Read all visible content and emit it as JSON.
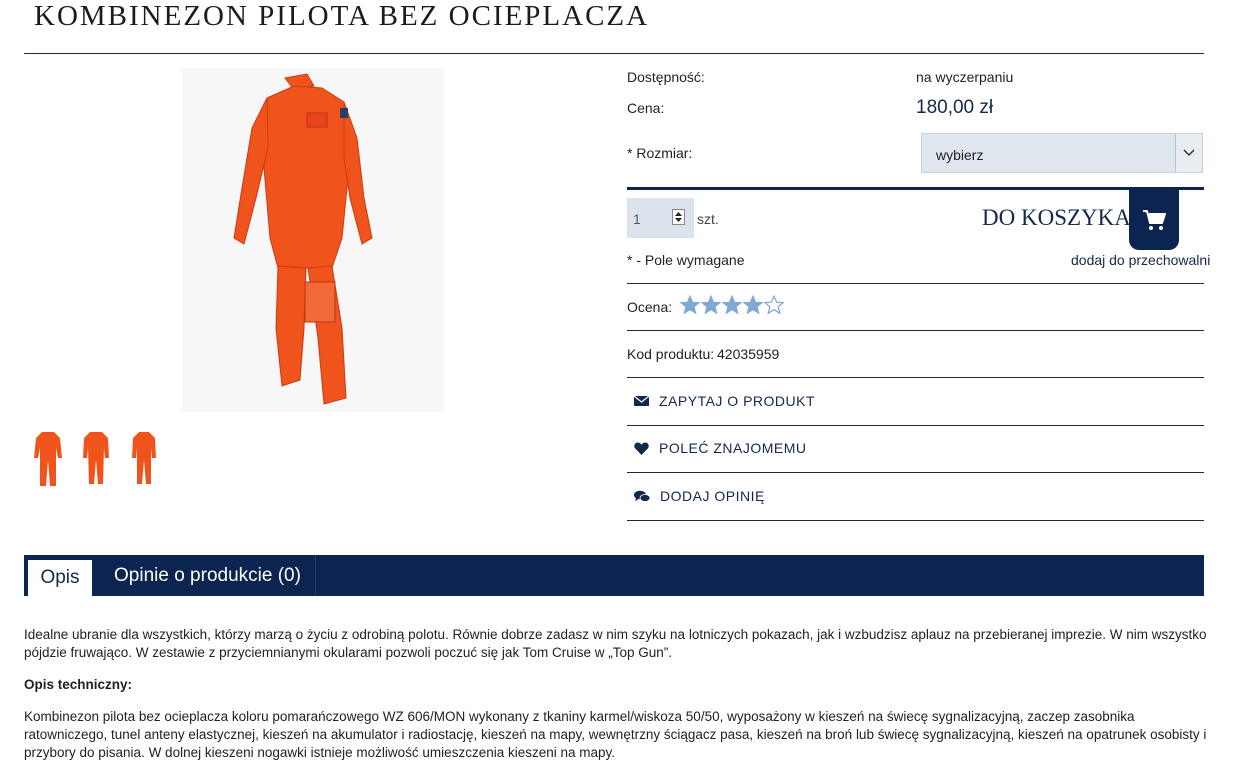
{
  "title": "KOMBINEZON PILOTA BEZ OCIEPLACZA",
  "product": {
    "availability_label": "Dostępność:",
    "availability_value": "na wyczerpaniu",
    "price_label": "Cena:",
    "price_value": "180,00 zł",
    "size_label": "* Rozmiar:",
    "size_selected": "wybierz",
    "quantity": "1",
    "unit": "szt.",
    "add_to_cart": "DO KOSZYKA",
    "required_note": "* - Pole wymagane",
    "store_link": "dodaj do przechowalni",
    "rating_label": "Ocena:",
    "rating": 4,
    "rating_max": 5,
    "code_label": "Kod produktu:",
    "code_value": "42035959"
  },
  "actions": [
    {
      "label": "ZAPYTAJ O PRODUKT",
      "icon": "envelope-icon"
    },
    {
      "label": "POLEĆ ZNAJOMEMU",
      "icon": "heart-icon"
    },
    {
      "label": "DODAJ OPINIĘ",
      "icon": "comments-icon"
    }
  ],
  "tabs": [
    {
      "label": "Opis"
    },
    {
      "label": "Opinie o produkcie (0)"
    }
  ],
  "description": {
    "intro": "Idealne ubranie dla wszystkich, którzy marzą o życiu z odrobiną polotu. Równie dobrze zadasz w nim szyku na lotniczych pokazach, jak i wzbudzisz aplauz na przebieranej imprezie. W nim wszystko pójdzie fruwająco. W zestawie z przyciemnianymi okularami pozwoli poczuć się jak Tom Cruise w „Top Gun”.",
    "tech_heading": "Opis techniczny:",
    "tech_text": "Kombinezon pilota bez ocieplacza koloru pomarańczowego WZ 606/MON wykonany z tkaniny karmel/wiskoza 50/50, wyposażony w kieszeń na świecę sygnalizacyjną, zaczep zasobnika ratowniczego, tunel anteny elastycznej, kieszeń na akumulator i radiostację, kieszeń na mapy, wewnętrzny ściągacz pasa, kieszeń na broń lub świecę sygnalizacyjną, kieszeń na opatrunek osobisty i przybory do pisania. W dolnej kieszeni nogawki istnieje możliwość umieszczenia kieszeni na mapy."
  },
  "colors": {
    "navy": "#0c2450",
    "orange": "#f0531c",
    "star": "#7fa8d4"
  }
}
